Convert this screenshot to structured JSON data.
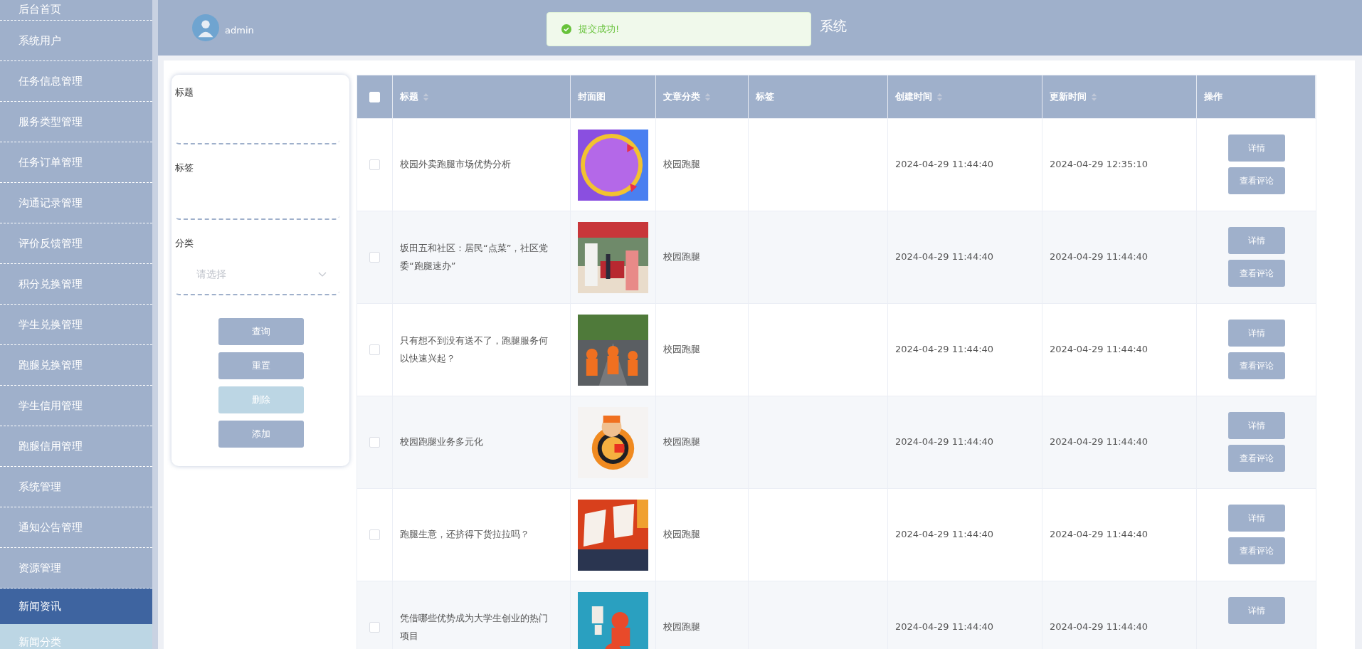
{
  "sidebar": {
    "items": [
      {
        "label": "后台首页",
        "selected": false
      },
      {
        "label": "系统用户",
        "selected": false
      },
      {
        "label": "任务信息管理",
        "selected": false
      },
      {
        "label": "服务类型管理",
        "selected": false
      },
      {
        "label": "任务订单管理",
        "selected": false
      },
      {
        "label": "沟通记录管理",
        "selected": false
      },
      {
        "label": "评价反馈管理",
        "selected": false
      },
      {
        "label": "积分兑换管理",
        "selected": false
      },
      {
        "label": "学生兑换管理",
        "selected": false
      },
      {
        "label": "跑腿兑换管理",
        "selected": false
      },
      {
        "label": "学生信用管理",
        "selected": false
      },
      {
        "label": "跑腿信用管理",
        "selected": false
      },
      {
        "label": "系统管理",
        "selected": false
      },
      {
        "label": "通知公告管理",
        "selected": false
      },
      {
        "label": "资源管理",
        "selected": false
      },
      {
        "label": "新闻资讯",
        "selected": true,
        "children": [
          {
            "label": "新闻分类",
            "selected": false
          }
        ]
      }
    ]
  },
  "header": {
    "user": "admin",
    "title": "系统"
  },
  "toast": {
    "kind": "success",
    "message": "提交成功!"
  },
  "filters": {
    "fields": [
      {
        "kind": "text",
        "label": "标题"
      },
      {
        "kind": "text",
        "label": "标签"
      },
      {
        "kind": "select",
        "label": "分类",
        "placeholder": "请选择"
      }
    ],
    "buttons": [
      {
        "label": "查询",
        "disabled": false
      },
      {
        "label": "重置",
        "disabled": false
      },
      {
        "label": "删除",
        "disabled": true
      },
      {
        "label": "添加",
        "disabled": false
      }
    ]
  },
  "table": {
    "select_all": {
      "checked": false
    },
    "columns": [
      {
        "label": "标题",
        "sortable": true
      },
      {
        "label": "封面图",
        "sortable": false
      },
      {
        "label": "文章分类",
        "sortable": true
      },
      {
        "label": "标签",
        "sortable": false
      },
      {
        "label": "创建时间",
        "sortable": true
      },
      {
        "label": "更新时间",
        "sortable": true
      },
      {
        "label": "操作",
        "sortable": false
      }
    ],
    "rows": [
      {
        "checked": false,
        "title": "校园外卖跑腿市场优势分析",
        "category": "校园跑腿",
        "created": "2024-04-29 11:44:40",
        "updated": "2024-04-29 12:35:10",
        "actions": [
          "详情",
          "查看评论"
        ]
      },
      {
        "checked": false,
        "title": "坂田五和社区：居民“点菜”，社区党委“跑腿速办”",
        "category": "校园跑腿",
        "created": "2024-04-29 11:44:40",
        "updated": "2024-04-29 11:44:40",
        "actions": [
          "详情",
          "查看评论"
        ]
      },
      {
        "checked": false,
        "title": "只有想不到没有送不了，跑腿服务何以快速兴起？",
        "category": "校园跑腿",
        "created": "2024-04-29 11:44:40",
        "updated": "2024-04-29 11:44:40",
        "actions": [
          "详情",
          "查看评论"
        ]
      },
      {
        "checked": false,
        "title": "校园跑腿业务多元化",
        "category": "校园跑腿",
        "created": "2024-04-29 11:44:40",
        "updated": "2024-04-29 11:44:40",
        "actions": [
          "详情",
          "查看评论"
        ]
      },
      {
        "checked": false,
        "title": "跑腿生意，还挤得下货拉拉吗？",
        "category": "校园跑腿",
        "created": "2024-04-29 11:44:40",
        "updated": "2024-04-29 11:44:40",
        "actions": [
          "详情",
          "查看评论"
        ]
      },
      {
        "checked": false,
        "title": "凭借哪些优势成为大学生创业的热门项目",
        "category": "校园跑腿",
        "created": "2024-04-29 11:44:40",
        "updated": "2024-04-29 11:44:40",
        "actions": [
          "详情"
        ]
      }
    ]
  }
}
